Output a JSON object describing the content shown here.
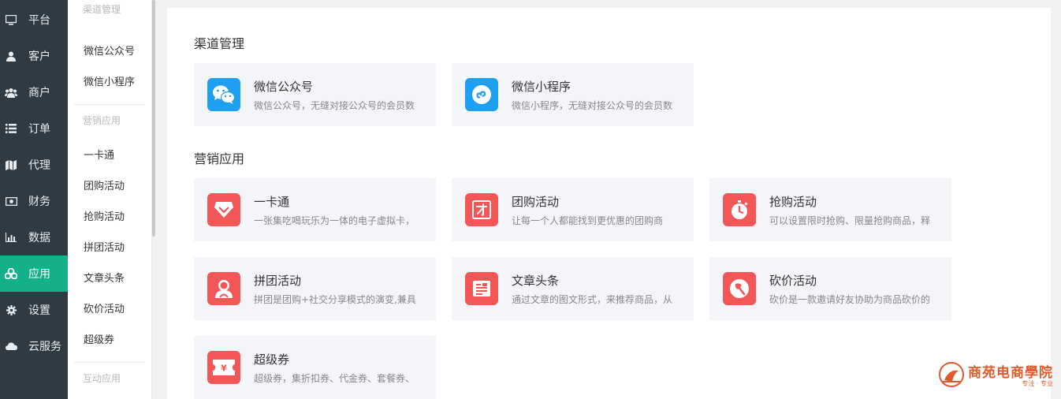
{
  "nav": {
    "items": [
      {
        "label": "平台",
        "icon": "monitor-icon"
      },
      {
        "label": "客户",
        "icon": "user-icon"
      },
      {
        "label": "商户",
        "icon": "users-icon"
      },
      {
        "label": "订单",
        "icon": "list-icon"
      },
      {
        "label": "代理",
        "icon": "map-icon"
      },
      {
        "label": "财务",
        "icon": "money-icon"
      },
      {
        "label": "数据",
        "icon": "bar-chart-icon"
      },
      {
        "label": "应用",
        "icon": "cubes-icon",
        "active": true
      },
      {
        "label": "设置",
        "icon": "gear-icon"
      },
      {
        "label": "云服务",
        "icon": "cloud-icon"
      }
    ],
    "active_color": "#14b08a"
  },
  "submenu": {
    "groups": [
      {
        "heading": "渠道管理",
        "items": [
          "微信公众号",
          "微信小程序"
        ]
      },
      {
        "heading": "营销应用",
        "items": [
          "一卡通",
          "团购活动",
          "抢购活动",
          "拼团活动",
          "文章头条",
          "砍价活动",
          "超级券"
        ]
      },
      {
        "heading": "互动应用",
        "items": []
      }
    ]
  },
  "main": {
    "sections": [
      {
        "title": "渠道管理",
        "cards": [
          {
            "title": "微信公众号",
            "desc": "微信公众号，无缝对接公众号的会员数",
            "icon": "wechat-icon",
            "color": "#1e9ff2"
          },
          {
            "title": "微信小程序",
            "desc": "微信小程序，无缝对接公众号的会员数",
            "icon": "miniprogram-icon",
            "color": "#1e9ff2"
          }
        ]
      },
      {
        "title": "营销应用",
        "cards": [
          {
            "title": "一卡通",
            "desc": "一张集吃喝玩乐为一体的电子虚拟卡，",
            "icon": "diamond-card-icon",
            "color": "#f25656"
          },
          {
            "title": "团购活动",
            "desc": "让每一个人都能找到更优惠的团购商",
            "icon": "group-buy-icon",
            "color": "#f25656"
          },
          {
            "title": "抢购活动",
            "desc": "可以设置限时抢购、限量抢购商品，释",
            "icon": "stopwatch-icon",
            "color": "#f25656"
          },
          {
            "title": "拼团活动",
            "desc": "拼团是团购+社交分享模式的演变,兼具",
            "icon": "people-icon",
            "color": "#f25656"
          },
          {
            "title": "文章头条",
            "desc": "通过文章的图文形式，来推荐商品，从",
            "icon": "article-icon",
            "color": "#f25656"
          },
          {
            "title": "砍价活动",
            "desc": "砍价是一款邀请好友协助为商品砍价的",
            "icon": "axe-icon",
            "color": "#f25656"
          },
          {
            "title": "超级券",
            "desc": "超级券，集折扣券、代金券、套餐券、",
            "icon": "coupon-icon",
            "color": "#f25656"
          }
        ]
      }
    ]
  },
  "watermark": {
    "title": "商苑电商學院",
    "subtitle": "专注 · 专业"
  }
}
